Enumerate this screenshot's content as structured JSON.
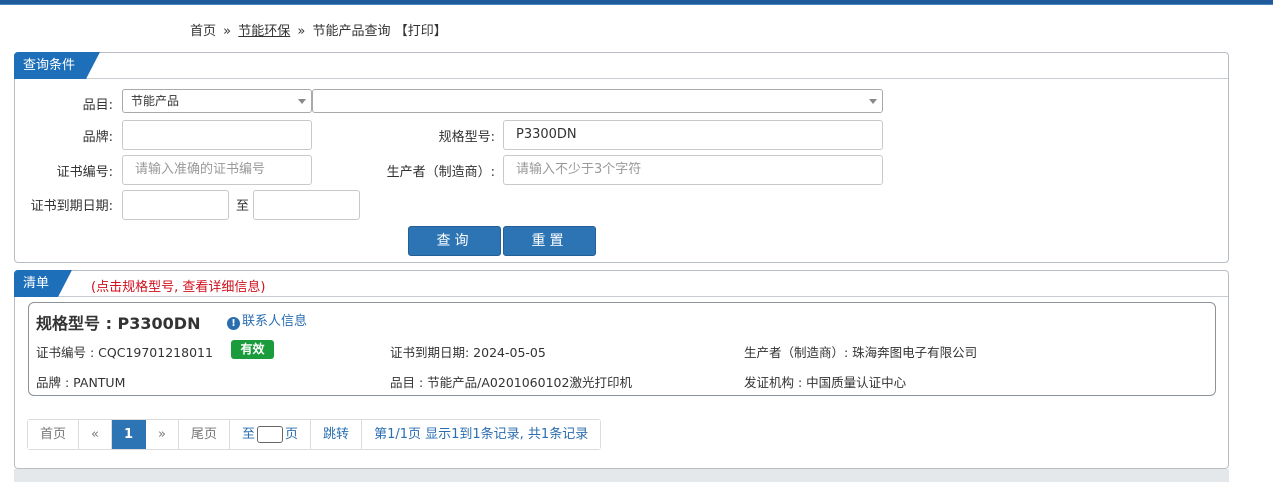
{
  "colors": {
    "topbar": "#1f5a9a",
    "tab": "#1d6fba",
    "button": "#2d74b4",
    "valid": "#1a9c3c",
    "hint": "#d0101c",
    "link": "#2a6eb0"
  },
  "breadcrumb": {
    "home": "首页",
    "sep1": "»",
    "category": "节能环保",
    "sep2": "»",
    "current": "节能产品查询",
    "print": "【打印】"
  },
  "query": {
    "title": "查询条件",
    "category_label": "品目:",
    "category_value": "节能产品",
    "subcategory_value": "",
    "brand_label": "品牌:",
    "brand_value": "",
    "model_label": "规格型号:",
    "model_value": "P3300DN",
    "cert_label": "证书编号:",
    "cert_placeholder": "请输入准确的证书编号",
    "maker_label": "生产者（制造商）:",
    "maker_placeholder": "请输入不少于3个字符",
    "expiry_label": "证书到期日期:",
    "expiry_to": "至",
    "search_button": "查询",
    "reset_button": "重置"
  },
  "list": {
    "title": "清单",
    "hint": "(点击规格型号, 查看详细信息)",
    "item": {
      "model": "规格型号 : P3300DN",
      "contact": "联系人信息",
      "cert_no": "证书编号 : CQC19701218011",
      "status": "有效",
      "expiry": "证书到期日期: 2024-05-05",
      "maker": "生产者（制造商）: 珠海奔图电子有限公司",
      "brand": "品牌 : PANTUM",
      "category": "品目 : 节能产品/A0201060102激光打印机",
      "issuer": "发证机构 : 中国质量认证中心"
    }
  },
  "pagination": {
    "first": "首页",
    "prev": "«",
    "current": "1",
    "next": "»",
    "last": "尾页",
    "goto_prefix": "至",
    "goto_suffix": "页",
    "jump": "跳转",
    "summary": "第1/1页  显示1到1条记录, 共1条记录"
  }
}
